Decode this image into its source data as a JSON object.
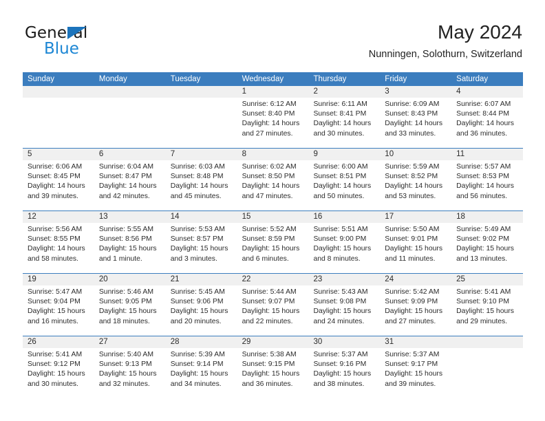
{
  "brand": {
    "name_top": "General",
    "name_bottom": "Blue",
    "triangle_color": "#1c74bc",
    "blue_color": "#1c86d4"
  },
  "header": {
    "title": "May 2024",
    "subtitle": "Nunningen, Solothurn, Switzerland"
  },
  "theme": {
    "header_blue": "#3b7dbe",
    "daynum_band": "#f0f0f0",
    "text": "#2b2b2b"
  },
  "calendar": {
    "weekdays": [
      "Sunday",
      "Monday",
      "Tuesday",
      "Wednesday",
      "Thursday",
      "Friday",
      "Saturday"
    ],
    "weeks": [
      {
        "days": [
          {
            "num": "",
            "lines": []
          },
          {
            "num": "",
            "lines": []
          },
          {
            "num": "",
            "lines": []
          },
          {
            "num": "1",
            "lines": [
              "Sunrise: 6:12 AM",
              "Sunset: 8:40 PM",
              "Daylight: 14 hours",
              "and 27 minutes."
            ]
          },
          {
            "num": "2",
            "lines": [
              "Sunrise: 6:11 AM",
              "Sunset: 8:41 PM",
              "Daylight: 14 hours",
              "and 30 minutes."
            ]
          },
          {
            "num": "3",
            "lines": [
              "Sunrise: 6:09 AM",
              "Sunset: 8:43 PM",
              "Daylight: 14 hours",
              "and 33 minutes."
            ]
          },
          {
            "num": "4",
            "lines": [
              "Sunrise: 6:07 AM",
              "Sunset: 8:44 PM",
              "Daylight: 14 hours",
              "and 36 minutes."
            ]
          }
        ]
      },
      {
        "days": [
          {
            "num": "5",
            "lines": [
              "Sunrise: 6:06 AM",
              "Sunset: 8:45 PM",
              "Daylight: 14 hours",
              "and 39 minutes."
            ]
          },
          {
            "num": "6",
            "lines": [
              "Sunrise: 6:04 AM",
              "Sunset: 8:47 PM",
              "Daylight: 14 hours",
              "and 42 minutes."
            ]
          },
          {
            "num": "7",
            "lines": [
              "Sunrise: 6:03 AM",
              "Sunset: 8:48 PM",
              "Daylight: 14 hours",
              "and 45 minutes."
            ]
          },
          {
            "num": "8",
            "lines": [
              "Sunrise: 6:02 AM",
              "Sunset: 8:50 PM",
              "Daylight: 14 hours",
              "and 47 minutes."
            ]
          },
          {
            "num": "9",
            "lines": [
              "Sunrise: 6:00 AM",
              "Sunset: 8:51 PM",
              "Daylight: 14 hours",
              "and 50 minutes."
            ]
          },
          {
            "num": "10",
            "lines": [
              "Sunrise: 5:59 AM",
              "Sunset: 8:52 PM",
              "Daylight: 14 hours",
              "and 53 minutes."
            ]
          },
          {
            "num": "11",
            "lines": [
              "Sunrise: 5:57 AM",
              "Sunset: 8:53 PM",
              "Daylight: 14 hours",
              "and 56 minutes."
            ]
          }
        ]
      },
      {
        "days": [
          {
            "num": "12",
            "lines": [
              "Sunrise: 5:56 AM",
              "Sunset: 8:55 PM",
              "Daylight: 14 hours",
              "and 58 minutes."
            ]
          },
          {
            "num": "13",
            "lines": [
              "Sunrise: 5:55 AM",
              "Sunset: 8:56 PM",
              "Daylight: 15 hours",
              "and 1 minute."
            ]
          },
          {
            "num": "14",
            "lines": [
              "Sunrise: 5:53 AM",
              "Sunset: 8:57 PM",
              "Daylight: 15 hours",
              "and 3 minutes."
            ]
          },
          {
            "num": "15",
            "lines": [
              "Sunrise: 5:52 AM",
              "Sunset: 8:59 PM",
              "Daylight: 15 hours",
              "and 6 minutes."
            ]
          },
          {
            "num": "16",
            "lines": [
              "Sunrise: 5:51 AM",
              "Sunset: 9:00 PM",
              "Daylight: 15 hours",
              "and 8 minutes."
            ]
          },
          {
            "num": "17",
            "lines": [
              "Sunrise: 5:50 AM",
              "Sunset: 9:01 PM",
              "Daylight: 15 hours",
              "and 11 minutes."
            ]
          },
          {
            "num": "18",
            "lines": [
              "Sunrise: 5:49 AM",
              "Sunset: 9:02 PM",
              "Daylight: 15 hours",
              "and 13 minutes."
            ]
          }
        ]
      },
      {
        "days": [
          {
            "num": "19",
            "lines": [
              "Sunrise: 5:47 AM",
              "Sunset: 9:04 PM",
              "Daylight: 15 hours",
              "and 16 minutes."
            ]
          },
          {
            "num": "20",
            "lines": [
              "Sunrise: 5:46 AM",
              "Sunset: 9:05 PM",
              "Daylight: 15 hours",
              "and 18 minutes."
            ]
          },
          {
            "num": "21",
            "lines": [
              "Sunrise: 5:45 AM",
              "Sunset: 9:06 PM",
              "Daylight: 15 hours",
              "and 20 minutes."
            ]
          },
          {
            "num": "22",
            "lines": [
              "Sunrise: 5:44 AM",
              "Sunset: 9:07 PM",
              "Daylight: 15 hours",
              "and 22 minutes."
            ]
          },
          {
            "num": "23",
            "lines": [
              "Sunrise: 5:43 AM",
              "Sunset: 9:08 PM",
              "Daylight: 15 hours",
              "and 24 minutes."
            ]
          },
          {
            "num": "24",
            "lines": [
              "Sunrise: 5:42 AM",
              "Sunset: 9:09 PM",
              "Daylight: 15 hours",
              "and 27 minutes."
            ]
          },
          {
            "num": "25",
            "lines": [
              "Sunrise: 5:41 AM",
              "Sunset: 9:10 PM",
              "Daylight: 15 hours",
              "and 29 minutes."
            ]
          }
        ]
      },
      {
        "days": [
          {
            "num": "26",
            "lines": [
              "Sunrise: 5:41 AM",
              "Sunset: 9:12 PM",
              "Daylight: 15 hours",
              "and 30 minutes."
            ]
          },
          {
            "num": "27",
            "lines": [
              "Sunrise: 5:40 AM",
              "Sunset: 9:13 PM",
              "Daylight: 15 hours",
              "and 32 minutes."
            ]
          },
          {
            "num": "28",
            "lines": [
              "Sunrise: 5:39 AM",
              "Sunset: 9:14 PM",
              "Daylight: 15 hours",
              "and 34 minutes."
            ]
          },
          {
            "num": "29",
            "lines": [
              "Sunrise: 5:38 AM",
              "Sunset: 9:15 PM",
              "Daylight: 15 hours",
              "and 36 minutes."
            ]
          },
          {
            "num": "30",
            "lines": [
              "Sunrise: 5:37 AM",
              "Sunset: 9:16 PM",
              "Daylight: 15 hours",
              "and 38 minutes."
            ]
          },
          {
            "num": "31",
            "lines": [
              "Sunrise: 5:37 AM",
              "Sunset: 9:17 PM",
              "Daylight: 15 hours",
              "and 39 minutes."
            ]
          },
          {
            "num": "",
            "lines": []
          }
        ]
      }
    ]
  }
}
